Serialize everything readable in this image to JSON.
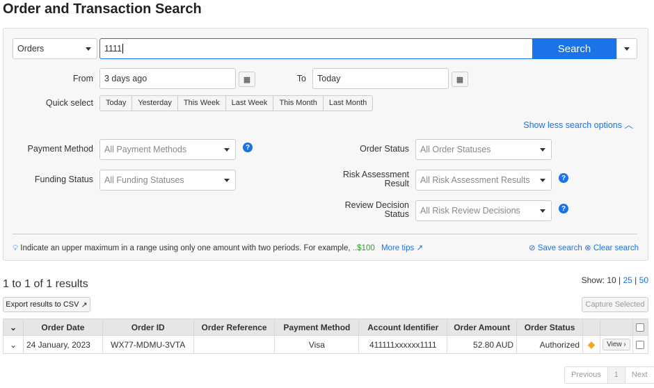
{
  "title": "Order and Transaction Search",
  "search": {
    "type": "Orders",
    "query": "1111",
    "button": "Search"
  },
  "from": {
    "label": "From",
    "value": "3 days ago"
  },
  "to": {
    "label": "To",
    "value": "Today"
  },
  "quick_select": {
    "label": "Quick select",
    "options": [
      "Today",
      "Yesterday",
      "This Week",
      "Last Week",
      "This Month",
      "Last Month"
    ]
  },
  "toggle_options": "Show less search options",
  "filters": {
    "payment_method": {
      "label": "Payment Method",
      "value": "All Payment Methods"
    },
    "funding_status": {
      "label": "Funding Status",
      "value": "All Funding Statuses"
    },
    "order_status": {
      "label": "Order Status",
      "value": "All Order Statuses"
    },
    "risk_assessment": {
      "label1": "Risk Assessment",
      "label2": "Result",
      "value": "All Risk Assessment Results"
    },
    "review_decision": {
      "label1": "Review Decision",
      "label2": "Status",
      "value": "All Risk Review Decisions"
    }
  },
  "tip": {
    "text": "Indicate an upper maximum in a range using only one amount with two periods. For example,",
    "example": "..$100",
    "more": "More tips"
  },
  "save_search": "Save search",
  "clear_search": "Clear search",
  "results": {
    "summary": "1 to 1 of 1 results",
    "show_label": "Show:",
    "show_options": [
      "10",
      "25",
      "50"
    ],
    "export": "Export results to CSV",
    "capture": "Capture Selected"
  },
  "table": {
    "headers": [
      "Order Date",
      "Order ID",
      "Order Reference",
      "Payment Method",
      "Account Identifier",
      "Order Amount",
      "Order Status"
    ],
    "rows": [
      {
        "date": "24 January, 2023",
        "id": "WX77-MDMU-3VTA",
        "reference": "",
        "method": "Visa",
        "account": "411111xxxxxx1111",
        "amount": "52.80 AUD",
        "status": "Authorized",
        "view": "View"
      }
    ]
  },
  "pagination": {
    "prev": "Previous",
    "page": "1",
    "next": "Next"
  },
  "colors": {
    "accent": "#1a73e8",
    "warning": "#f5a623",
    "green": "#2e9e2e"
  }
}
